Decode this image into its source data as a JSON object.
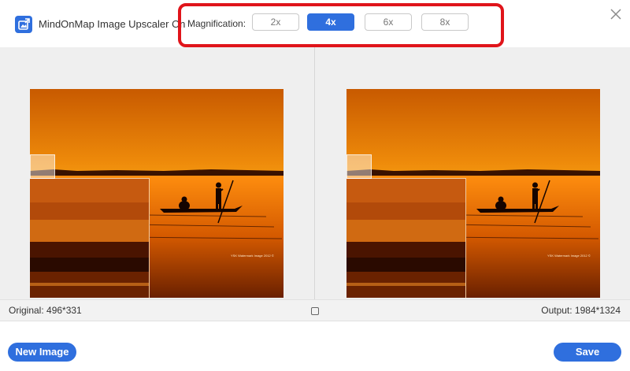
{
  "header": {
    "app_title": "MindOnMap Image Upscaler Online",
    "magnification_label": "Magnification:",
    "magnification_options": [
      "2x",
      "4x",
      "6x",
      "8x"
    ],
    "selected_magnification": "4x"
  },
  "preview": {
    "watermark": "YSK Watermark Image 2012 ©"
  },
  "info": {
    "original_label": "Original: 496*331",
    "output_label": "Output: 1984*1324"
  },
  "footer": {
    "new_image_label": "New Image",
    "save_label": "Save"
  },
  "colors": {
    "accent": "#2f6fde",
    "annotation": "#e0141a"
  },
  "icons": [
    "image-upscaler-app-icon",
    "close-icon"
  ]
}
